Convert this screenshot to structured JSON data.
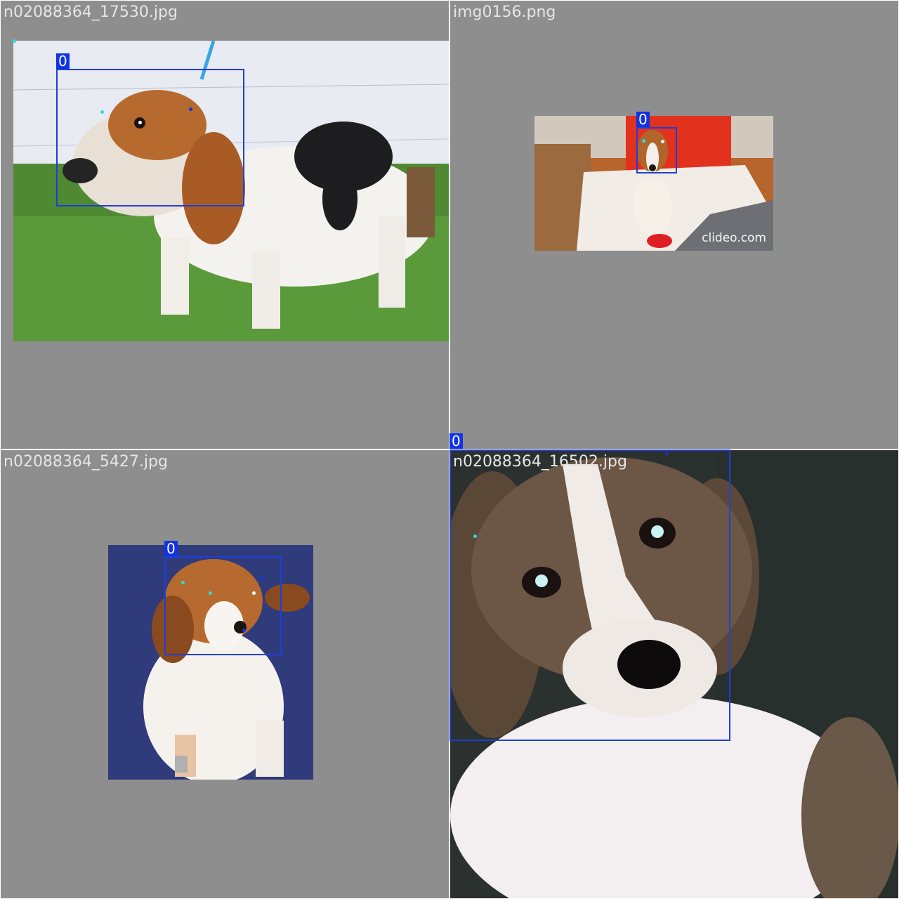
{
  "tiles": [
    {
      "filename": "n02088364_17530.jpg",
      "label": "0"
    },
    {
      "filename": "img0156.png",
      "label": "0",
      "watermark": "clideo.com"
    },
    {
      "filename": "n02088364_5427.jpg",
      "label": "0"
    },
    {
      "filename": "n02088364_16502.jpg",
      "label": "0"
    }
  ],
  "colors": {
    "background": "#8e8e8e",
    "bbox": "#1f3fd6",
    "label_bg": "#1133e6",
    "keypoint_cyan": "#22e0e0"
  }
}
